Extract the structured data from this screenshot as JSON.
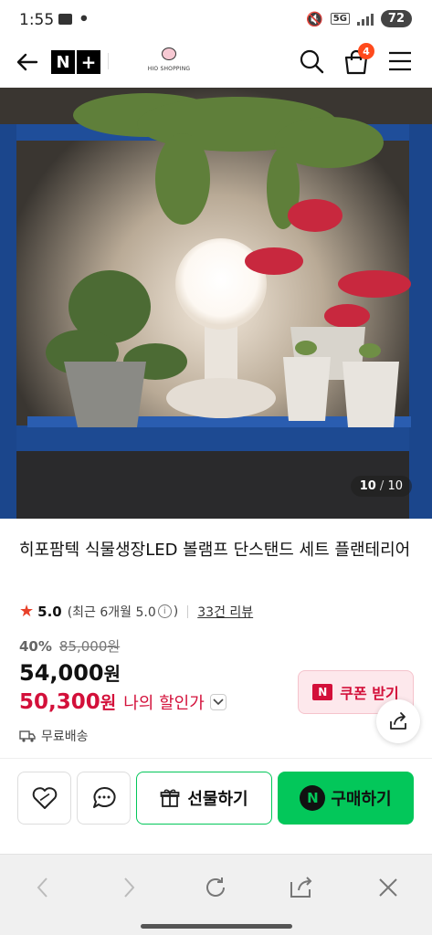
{
  "status_bar": {
    "time": "1:55",
    "network": "5G",
    "battery": "72"
  },
  "header": {
    "logo_n": "N",
    "logo_plus": "+",
    "store_name": "HIO SHOPPING",
    "cart_count": "4"
  },
  "gallery": {
    "current": "10",
    "separator": "/",
    "total": "10"
  },
  "product": {
    "title": "히포팜텍 식물생장LED 볼램프 단스탠드 세트 플랜테리어",
    "rating": "5.0",
    "rating_detail_prefix": "(최근 6개월 5.0",
    "rating_detail_suffix": ")",
    "info_glyph": "i",
    "review_count": "33건 리뷰",
    "discount_rate": "40%",
    "original_price": "85,000원",
    "sale_price": "54,000",
    "sale_unit": "원",
    "my_price": "50,300",
    "my_price_unit": "원",
    "my_price_label": "나의 할인가",
    "shipping": "무료배송"
  },
  "coupon": {
    "icon_text": "N",
    "label": "쿠폰 받기"
  },
  "actions": {
    "gift_label": "선물하기",
    "buy_icon_text": "N",
    "buy_label": "구매하기"
  },
  "colors": {
    "brand_green": "#03c75a",
    "price_red": "#d3103a",
    "cart_badge": "#ff4a1c",
    "shelf_blue": "#1f4e9a"
  },
  "icons": [
    "back-arrow-icon",
    "search-icon",
    "cart-icon",
    "menu-icon",
    "star-icon",
    "info-icon",
    "chevron-down-icon",
    "share-icon",
    "truck-icon",
    "heart-icon",
    "chat-icon",
    "gift-icon",
    "nav-back-icon",
    "nav-forward-icon",
    "refresh-icon",
    "share-out-icon",
    "close-icon"
  ]
}
